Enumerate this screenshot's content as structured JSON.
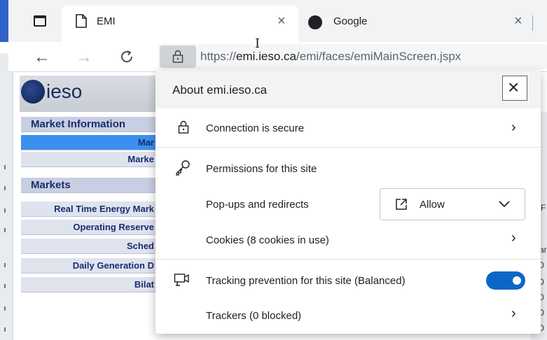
{
  "tabs": [
    {
      "title": "EMI",
      "close_glyph": "×"
    },
    {
      "title": "Google",
      "close_glyph": "×"
    }
  ],
  "toolbar": {
    "url_domain": "emi.ieso.ca",
    "url_prefix": "https://",
    "url_path": "/emi/faces/emiMainScreen.jspx"
  },
  "webpage": {
    "logo_text": "ieso",
    "menu": [
      {
        "label": "Market Information",
        "type": "head"
      },
      {
        "label": "Mar",
        "type": "sel"
      },
      {
        "label": "Marke",
        "type": "item"
      },
      {
        "label": "Markets",
        "type": "head"
      },
      {
        "label": "Real Time Energy Mark",
        "type": "item"
      },
      {
        "label": "Operating Reserve",
        "type": "item"
      },
      {
        "label": "Sched",
        "type": "item"
      },
      {
        "label": "Daily Generation D",
        "type": "item"
      },
      {
        "label": "Bilat",
        "type": "item"
      }
    ],
    "right_edge_text": [
      "F",
      "ar",
      "0",
      "0",
      "0",
      "0",
      "0"
    ]
  },
  "site_info": {
    "title": "About emi.ieso.ca",
    "close_glyph": "×",
    "connection_label": "Connection is secure",
    "permissions_label": "Permissions for this site",
    "popups_label": "Pop-ups and redirects",
    "popups_value": "Allow",
    "cookies_label": "Cookies (8 cookies in use)",
    "tracking_label": "Tracking prevention for this site (Balanced)",
    "tracking_enabled": true,
    "trackers_label": "Trackers (0 blocked)",
    "accent_color": "#0a67c8"
  }
}
